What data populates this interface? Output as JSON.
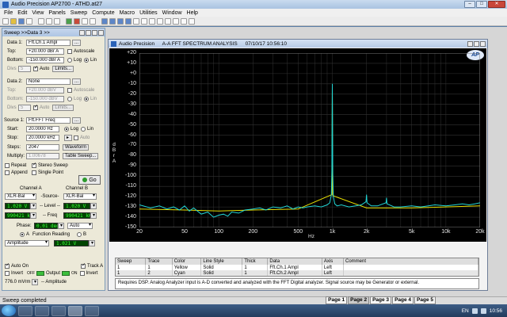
{
  "app": {
    "title": "Audio Precision AP2700 - ATHD.at27",
    "controls": {
      "minimize": "–",
      "maximize": "□",
      "close": "✕"
    }
  },
  "menu": [
    "File",
    "Edit",
    "View",
    "Panels",
    "Sweep",
    "Compute",
    "Macro",
    "Utilities",
    "Window",
    "Help"
  ],
  "sweep_panel": {
    "title": "Sweep >>Data 3 >>",
    "data1": {
      "label": "Data 1:",
      "value": "Fft.Ch.1 Ampl",
      "top_label": "Top:",
      "top": "+20.000 dBr A",
      "bottom_label": "Bottom:",
      "bottom": "-150.000 dBr A",
      "autoscale": "Autoscale",
      "log": "Log",
      "lin": "Lin",
      "divs_label": "Divs",
      "divs": "5",
      "auto": "Auto",
      "limits": "Limits..."
    },
    "data2": {
      "label": "Data 2:",
      "value": "None",
      "top_label": "Top:",
      "top": "+20.000 dBV",
      "bottom_label": "Bottom:",
      "bottom": "-150.000 dBV",
      "autoscale": "Autoscale",
      "log": "Log",
      "lin": "Lin",
      "divs_label": "Divs",
      "divs": "5",
      "auto": "Auto",
      "limits": "Limits..."
    },
    "source1": {
      "label": "Source 1:",
      "value": "Fft.FFT Freq",
      "start_label": "Start:",
      "start": "20.0000 Hz",
      "stop_label": "Stop:",
      "stop": "20.0000 kHz",
      "log": "Log",
      "lin": "Lin",
      "auto": "Auto",
      "steps_label": "Steps:",
      "steps": "2047",
      "multiply_label": "Multiply:",
      "multiply": "1.00678",
      "waveform": "Waveform",
      "table_sweep": "Table Sweep..."
    },
    "options": {
      "repeat": "Repeat",
      "stereo_sweep": "Stereo Sweep",
      "append": "Append",
      "single_point": "Single Point",
      "go": "Go"
    },
    "channels": {
      "a_header": "Channel A",
      "b_header": "Channel B",
      "a_source": "XLR-Bal",
      "source_label": "-Source-",
      "b_source": "XLR-Bal",
      "a_level": "1.020 V",
      "level_label": "-- Level --",
      "b_level": "1.020 V",
      "a_freq": "990421 kHz",
      "freq_label": "-- Freq",
      "b_freq": "990421 kHz",
      "phase_label": "Phase:",
      "phase": "0.01 deg",
      "phase_mode": "Auto",
      "function_a": "A",
      "function_reading": "Function Reading",
      "function_b": "B",
      "function_mode": "Amplitude",
      "function_value": "1.021 V"
    },
    "bottom": {
      "auto_on": "Auto On",
      "track_a": "Track A",
      "invert_left": "Invert",
      "output": "Output",
      "off_left": "OFF",
      "on_right": "ON",
      "invert_right": "Invert",
      "level_value": "776.0 mVrm",
      "amplitude": "-- Amplitude"
    }
  },
  "graph": {
    "window_title_app": "Audio Precision",
    "window_title": "A-A FFT SPECTRUM ANALYSIS",
    "timestamp": "07/10/17 10:56:10",
    "logo": "AP",
    "y_axis_label": [
      "d",
      "B",
      "r",
      "",
      "A"
    ],
    "x_axis_label": "Hz",
    "legend_headers": [
      "Sweep",
      "Trace",
      "Color",
      "Line Style",
      "Thick",
      "Data",
      "Axis",
      "Comment"
    ],
    "legend_rows": [
      {
        "sweep": "1",
        "trace": "1",
        "color": "Yellow",
        "line_style": "Solid",
        "thick": "1",
        "data": "Fft.Ch.1 Ampl",
        "axis": "Left",
        "comment": ""
      },
      {
        "sweep": "1",
        "trace": "2",
        "color": "Cyan",
        "line_style": "Solid",
        "thick": "1",
        "data": "Fft.Ch.2 Ampl",
        "axis": "Left",
        "comment": ""
      }
    ],
    "description": "Requires DSP.  Analog Analyzer input is A-D converted and analyzed with the FFT Digital analyzer.  Signal source may be Generator or external."
  },
  "chart_data": {
    "type": "line",
    "title": "A-A FFT SPECTRUM ANALYSIS",
    "xlabel": "Hz",
    "ylabel": "dBr A",
    "x_scale": "log",
    "xlim": [
      20,
      20000
    ],
    "ylim": [
      -150,
      20
    ],
    "x_ticks": [
      "20",
      "50",
      "100",
      "200",
      "500",
      "1k",
      "2k",
      "5k",
      "10k",
      "20k"
    ],
    "x_tick_values": [
      20,
      50,
      100,
      200,
      500,
      1000,
      2000,
      5000,
      10000,
      20000
    ],
    "y_ticks": [
      "+20",
      "+10",
      "+0",
      "-10",
      "-20",
      "-30",
      "-40",
      "-50",
      "-60",
      "-70",
      "-80",
      "-90",
      "-100",
      "-110",
      "-120",
      "-130",
      "-140",
      "-150"
    ],
    "y_tick_values": [
      20,
      10,
      0,
      -10,
      -20,
      -30,
      -40,
      -50,
      -60,
      -70,
      -80,
      -90,
      -100,
      -110,
      -120,
      -130,
      -140,
      -150
    ],
    "grid": true,
    "series": [
      {
        "name": "Fft.Ch.2 Ampl",
        "color": "#22d4d4",
        "x": [
          20,
          25,
          30,
          35,
          40,
          45,
          50,
          55,
          60,
          70,
          80,
          90,
          100,
          110,
          120,
          130,
          150,
          170,
          200,
          230,
          260,
          300,
          350,
          400,
          450,
          500,
          550,
          600,
          700,
          800,
          900,
          950,
          980,
          990,
          1000,
          1010,
          1020,
          1050,
          1100,
          1200,
          1400,
          1600,
          1800,
          1980,
          2000,
          2020,
          2200,
          2500,
          2970,
          3000,
          3030,
          3500,
          4000,
          5000,
          6000,
          7000,
          8000,
          10000,
          12000,
          14000,
          16000,
          18000,
          20000
        ],
        "y": [
          -128,
          -131,
          -129,
          -132,
          -130,
          -133,
          -129,
          -134,
          -131,
          -137,
          -135,
          -140,
          -138,
          -137,
          -139,
          -135,
          -136,
          -133,
          -132,
          -131,
          -133,
          -130,
          -131,
          -129,
          -132,
          -130,
          -131,
          -130,
          -129,
          -130,
          -128,
          -126,
          -118,
          -95,
          -10,
          -98,
          -120,
          -127,
          -129,
          -128,
          -130,
          -129,
          -128,
          -125,
          -118,
          -126,
          -129,
          -129,
          -126,
          -121,
          -127,
          -130,
          -130,
          -129,
          -130,
          -129,
          -128,
          -129,
          -128,
          -127,
          -128,
          -127,
          -126
        ]
      },
      {
        "name": "Fft.Ch.1 Ampl",
        "color": "#e8e000",
        "x": [
          20,
          50,
          100,
          200,
          500,
          990,
          1000,
          1010,
          2000,
          5000,
          10000,
          20000
        ],
        "y": [
          -132,
          -133,
          -134,
          -133,
          -132,
          -118,
          -12,
          -119,
          -131,
          -131,
          -130,
          -129
        ]
      }
    ]
  },
  "status": {
    "text": "Sweep completed",
    "pages": [
      "Page 1",
      "Page 2",
      "Page 3",
      "Page 4",
      "Page 5"
    ],
    "active_page": "Page 2"
  },
  "taskbar": {
    "lang": "EN",
    "time": "10:56"
  }
}
